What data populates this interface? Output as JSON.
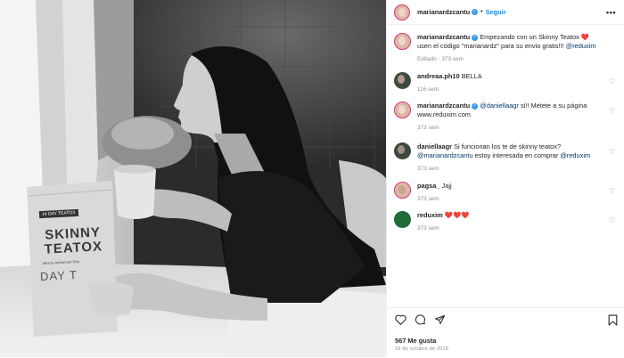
{
  "post": {
    "username": "marianardzcantu",
    "follow_label": "Seguir",
    "more_label": "•••",
    "product_lines": [
      "SKINNY",
      "TEATOX"
    ],
    "product_sub": "Mezcla herbal con Goji",
    "product_day": "DAY T",
    "product_tag": "14 DAY TEATOX"
  },
  "caption": {
    "username": "marianardzcantu",
    "text_1": "Empezando con un Skinny Teatox",
    "heart": "❤️",
    "text_2": "usen el código \"marianardz\" para su envio gratis!!!",
    "mention": "@reduxim",
    "meta": "Editado · 373 sem"
  },
  "comments": [
    {
      "username": "andreaa.ph10",
      "text": "BELLA",
      "meta": "116 sem"
    },
    {
      "username": "marianardzcantu",
      "mention": "@daniellaagr",
      "text": "si!! Metete a su página www.reduxim.com",
      "meta": "373 sem"
    },
    {
      "username": "daniellaagr",
      "text": "Si funcionan los te de skinny teatox?",
      "mention": "@marianardzcantu",
      "text_2": "estoy interesada en comprar",
      "mention_2": "@reduxim",
      "meta": "373 sem"
    },
    {
      "username": "pagsa_",
      "text": "Jajj",
      "meta": "373 sem"
    },
    {
      "username": "reduxim",
      "text": "❤️❤️❤️",
      "meta": "373 sem"
    }
  ],
  "footer": {
    "likes": "567 Me gusta",
    "date": "16 de octubre de 2016"
  },
  "icons": {
    "like": "heart-icon",
    "comment": "comment-icon",
    "share": "share-icon",
    "save": "bookmark-icon"
  },
  "colors": {
    "link": "#0095f6",
    "mention": "#00376b",
    "muted": "#8e8e8e",
    "verified": "#3897f0",
    "story_ring": "#e1306c"
  }
}
